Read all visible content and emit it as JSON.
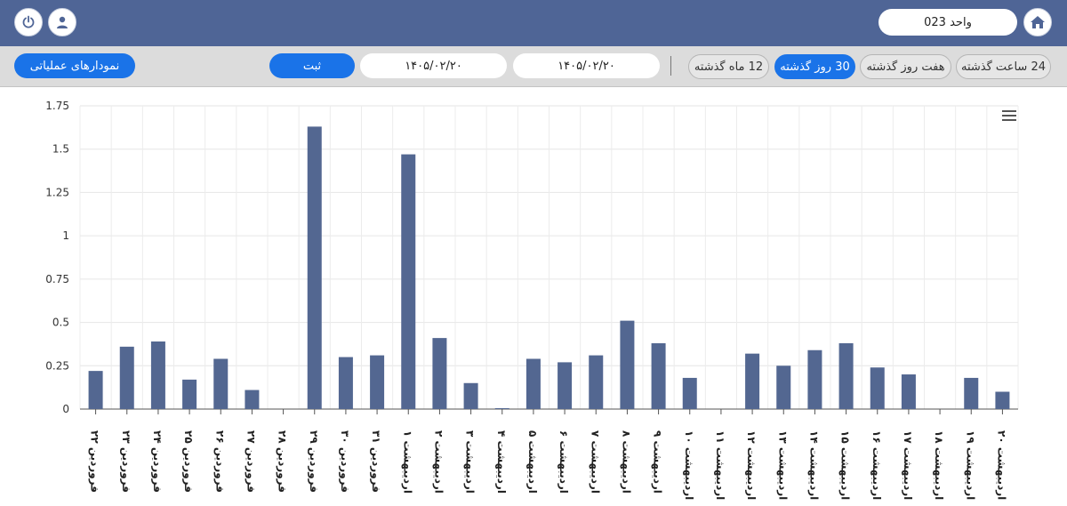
{
  "header": {
    "unit_label": "واحد 023",
    "home_icon": "home-icon",
    "user_icon": "user-icon",
    "power_icon": "power-icon"
  },
  "toolbar": {
    "range_24h": "24 ساعت گذشته",
    "range_7d": "هفت روز گذشته",
    "range_30d": "30 روز گذشته",
    "range_12m": "12 ماه گذشته",
    "date_from": "۱۴۰۵/۰۲/۲۰",
    "date_to": "۱۴۰۵/۰۲/۲۰",
    "submit_label": "ثبت",
    "ops_charts_label": "نمودارهای عملیاتی"
  },
  "colors": {
    "header_bg": "#4f6596",
    "bar": "#536791",
    "accent": "#1a73e8"
  },
  "chart_data": {
    "type": "bar",
    "ylim": [
      0,
      1.75
    ],
    "yticks": [
      "0",
      "0.25",
      "0.5",
      "0.75",
      "1",
      "1.25",
      "1.5",
      "1.75"
    ],
    "grid": true,
    "categories": [
      "فروردین ۲۲",
      "فروردین ۲۳",
      "فروردین ۲۴",
      "فروردین ۲۵",
      "فروردین ۲۶",
      "فروردین ۲۷",
      "فروردین ۲۸",
      "فروردین ۲۹",
      "فروردین ۳۰",
      "فروردین ۳۱",
      "اردیبهشت ۱",
      "اردیبهشت ۲",
      "اردیبهشت ۳",
      "اردیبهشت ۴",
      "اردیبهشت ۵",
      "اردیبهشت ۶",
      "اردیبهشت ۷",
      "اردیبهشت ۸",
      "اردیبهشت ۹",
      "اردیبهشت ۱۰",
      "اردیبهشت ۱۱",
      "اردیبهشت ۱۲",
      "اردیبهشت ۱۳",
      "اردیبهشت ۱۴",
      "اردیبهشت ۱۵",
      "اردیبهشت ۱۶",
      "اردیبهشت ۱۷",
      "اردیبهشت ۱۸",
      "اردیبهشت ۱۹",
      "اردیبهشت ۲۰"
    ],
    "values": [
      0.22,
      0.36,
      0.39,
      0.17,
      0.29,
      0.11,
      0,
      1.63,
      0.3,
      0.31,
      1.47,
      0.41,
      0.15,
      0.005,
      0.29,
      0.27,
      0.31,
      0.51,
      0.38,
      0.18,
      0,
      0.32,
      0.25,
      0.34,
      0.38,
      0.24,
      0.2,
      0,
      0.18,
      0.1
    ]
  }
}
